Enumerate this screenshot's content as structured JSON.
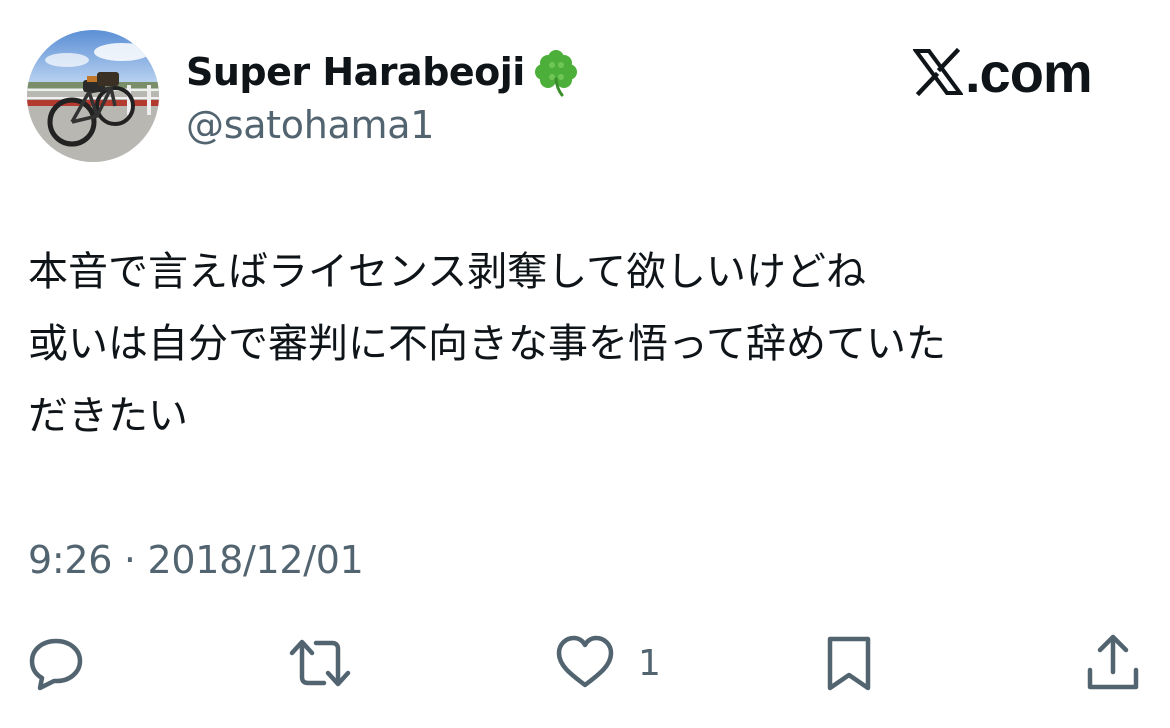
{
  "author": {
    "display_name": "Super Harabeoji",
    "name_emoji": "clover-icon",
    "handle": "@satohama1",
    "avatar": "avatar-bicycle-photo"
  },
  "site": {
    "logo_icon": "x-logo-icon",
    "domain": ".com"
  },
  "tweet": {
    "lines": [
      "本音で言えばライセンス剥奪して欲しいけどね",
      "或いは自分で審判に不向きな事を悟って辞めていた",
      "だきたい"
    ],
    "timestamp": "9:26 · 2018/12/01"
  },
  "actions": {
    "reply_icon": "reply-icon",
    "retweet_icon": "retweet-icon",
    "like_icon": "heart-icon",
    "like_count": "1",
    "bookmark_icon": "bookmark-icon",
    "share_icon": "share-icon"
  },
  "colors": {
    "text_primary": "#0f1419",
    "text_secondary": "#536471",
    "icon": "#536471",
    "clover": "#4caf3a"
  }
}
